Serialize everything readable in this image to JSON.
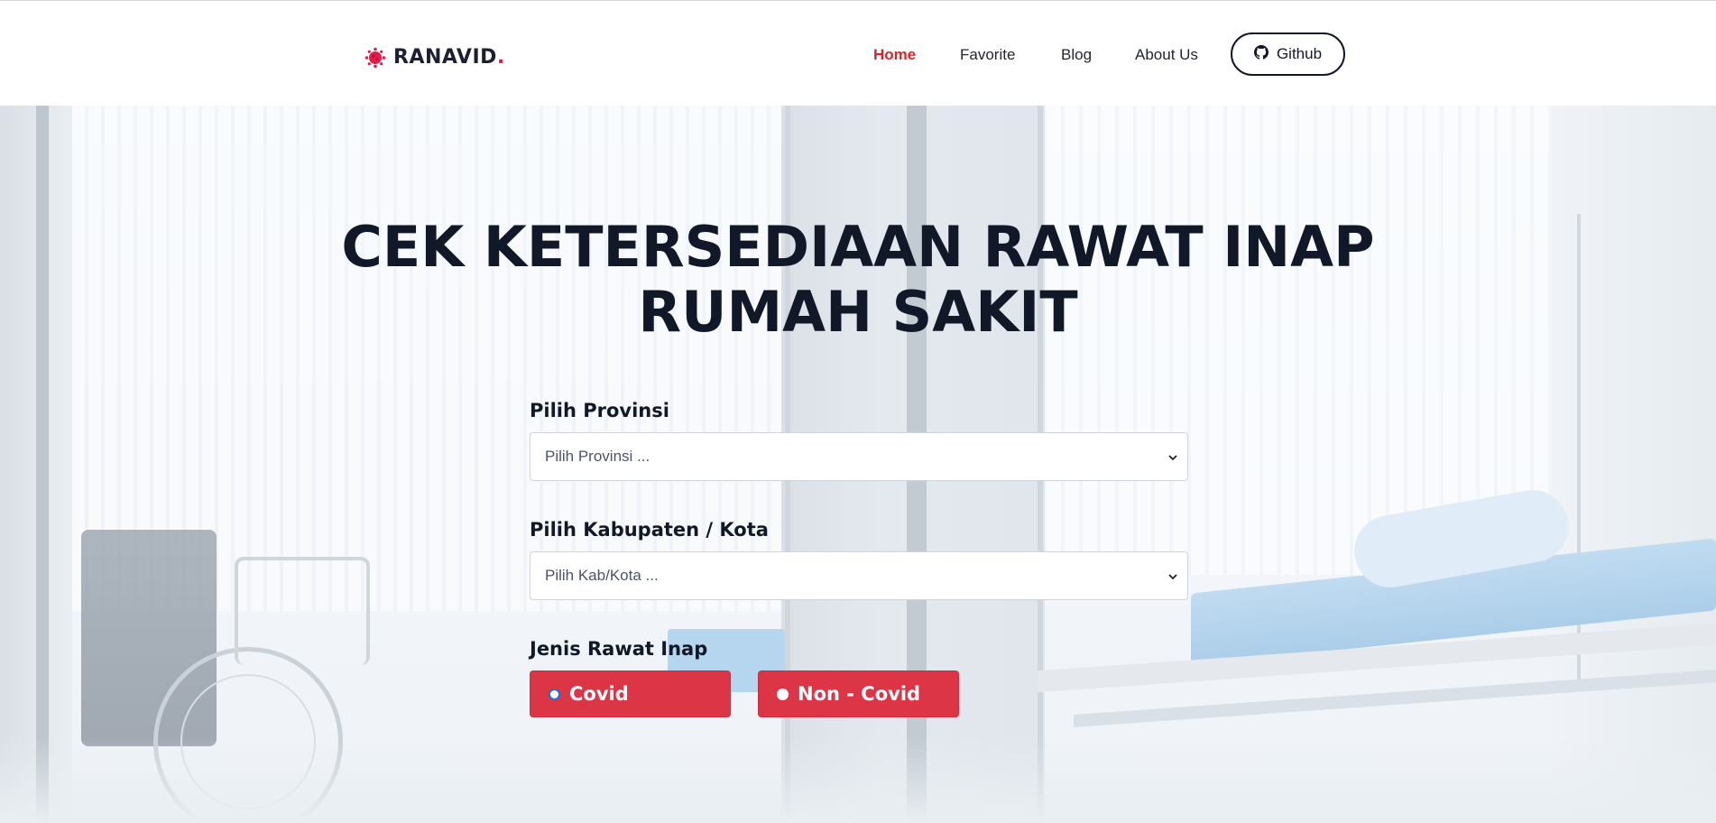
{
  "brand": {
    "name": "RANAVID",
    "suffix": "."
  },
  "nav": {
    "home": "Home",
    "favorite": "Favorite",
    "blog": "Blog",
    "about": "About Us",
    "github": "Github"
  },
  "hero": {
    "title_line1": "CEK KETERSEDIAAN RAWAT INAP",
    "title_line2": "RUMAH SAKIT"
  },
  "form": {
    "province_label": "Pilih Provinsi",
    "province_selected": "Pilih Provinsi ...",
    "city_label": "Pilih Kabupaten / Kota",
    "city_selected": "Pilih Kab/Kota ...",
    "type_label": "Jenis Rawat Inap",
    "options": [
      "Covid",
      "Non - Covid"
    ]
  },
  "colors": {
    "accent": "#dc3545",
    "nav_active": "#dc2626",
    "text_dark": "#111827"
  },
  "icons": {
    "logo": "virus-icon",
    "github": "github-icon",
    "select": "chevron-down-icon"
  }
}
